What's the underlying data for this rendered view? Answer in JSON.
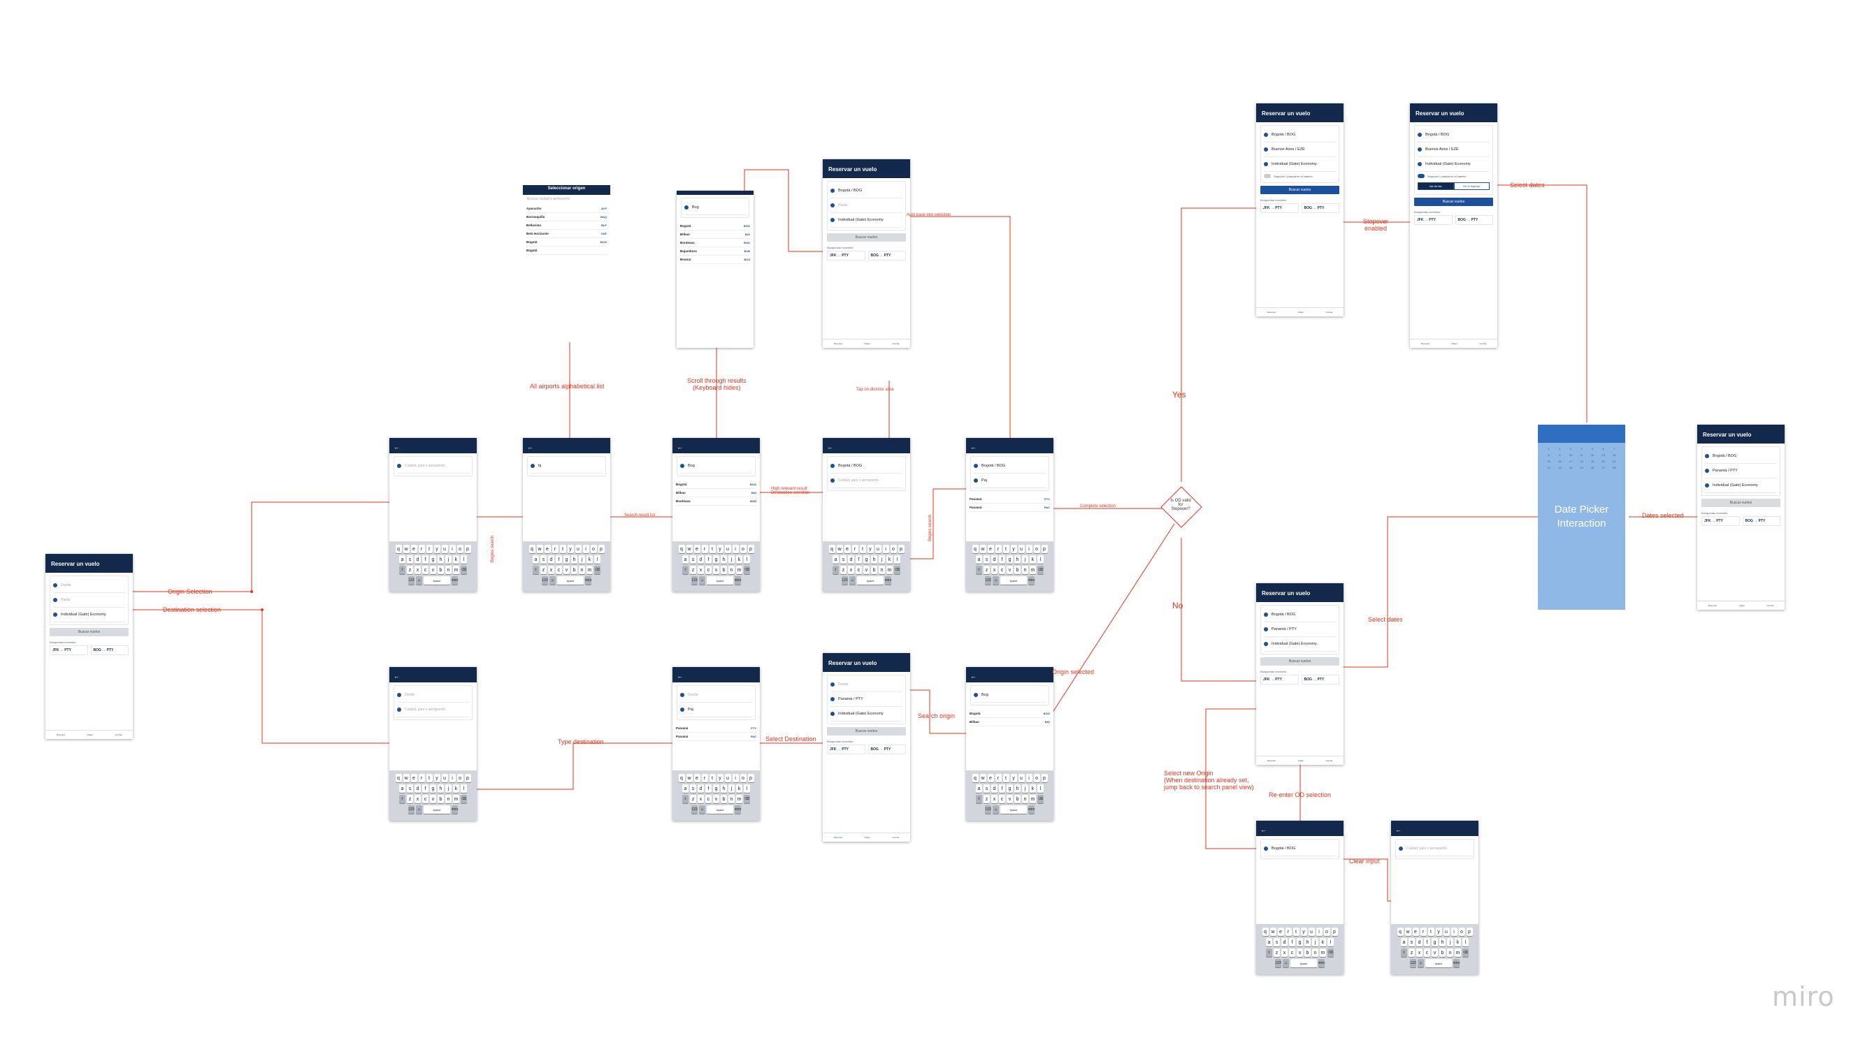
{
  "labels": {
    "origin_selection": "Origin Selection",
    "destination_selection": "Destination selection",
    "all_airports": "All airports alphabetical list",
    "scroll_results": "Scroll through results\n(Keyboard hides)",
    "tap_dismiss": "Tap on dismiss area",
    "auto_back": "Auto back into selection",
    "begins_search_1": "Begins search",
    "begins_search_2": "Begins search",
    "search_result_list": "Search result list",
    "high_relevance": "High relevant result\nDestination selection",
    "type_destination": "Type destination",
    "select_destination": "Select Destination",
    "search_origin": "Search origin",
    "origin_selected": "Origin selected",
    "complete_selection": "Complete selection",
    "yes": "Yes",
    "no": "No",
    "stopover_enabled": "Stopover\nenabled",
    "select_dates_top": "Select dates",
    "select_dates_bottom": "Select dates",
    "dates_selected": "Dates selected",
    "reenter_od": "Re-enter OD selection",
    "select_new_origin": "Select new Origin\n(When destination already set,\njump back to search panel view)",
    "clear_input": "Clear input",
    "diamond_text": "Is OD valid\nfor\nStopover?"
  },
  "screens": {
    "title": "Reservar un vuelo",
    "desde": "Desde",
    "hasta": "Hasta",
    "bogota": "Bogotá / BOG",
    "panama": "Panamá / PTY",
    "buenos_aires": "Buenos Aires / EZE",
    "pasajeros": "Individual (Gate) Economy",
    "buscar": "Buscar vuelos",
    "recent": "Búsquedas recientes",
    "chip1": "JFK → PTY",
    "chip2": "BOG → PTY",
    "placeholder": "Ciudad, país o aeropuerto",
    "query_bg": "bj",
    "query_bog": "Bog",
    "query_paj": "Paj",
    "query_pan": "Pan",
    "airports_title": "Seleccionar origen",
    "airports_search": "Buscar ciudad o aeropuerto",
    "stopover_toggle": "Stopover / parada en el camino",
    "seg_one": "Ida de ida",
    "seg_two": "En el regreso",
    "date_picker_1": "Date Picker",
    "date_picker_2": "Interaction",
    "tab_book": "Reservar",
    "tab_trips": "Viajes",
    "tab_account": "Cuenta"
  },
  "airport_list": [
    {
      "name": "Ayacucho",
      "sub": "Aeropuerto Alfredo Mendivil Duarte",
      "code": "AYP"
    },
    {
      "name": "Barranquilla",
      "sub": "Aeropuerto Ernesto Cortissoz",
      "code": "BAQ"
    },
    {
      "name": "Bellavista",
      "sub": "Aeropuerto Huallaga",
      "code": "BLP"
    },
    {
      "name": "Belo Horizonte",
      "sub": "Aeropuerto Confins",
      "code": "CNF"
    },
    {
      "name": "Bogotá",
      "sub": "El Dorado",
      "code": "BOG"
    },
    {
      "name": "Bogotá",
      "sub": "Guaymaral",
      "code": ""
    }
  ],
  "search_list": [
    {
      "name": "Bogotá",
      "sub": "Aeropuerto El Dorado",
      "code": "BOG"
    },
    {
      "name": "Bilbao",
      "sub": "Aeropuerto de Bilbao",
      "code": "BIO"
    },
    {
      "name": "Bordeaux",
      "sub": "Aeropuerto Mérignac",
      "code": "BOD"
    },
    {
      "name": "Bujumbura",
      "sub": "Aeropuerto Internacional",
      "code": "BJM"
    },
    {
      "name": "Boston",
      "sub": "Logan International",
      "code": "BOS"
    },
    {
      "name": "Bogotá",
      "sub": "Guaymaral",
      "code": ""
    }
  ],
  "destination_list": [
    {
      "name": "Panamá",
      "sub": "Aeropuerto Tocumen",
      "code": "PTY"
    },
    {
      "name": "Panamá",
      "sub": "Albrook",
      "code": "PAC"
    }
  ],
  "miro": "miro",
  "colors": {
    "navy": "#13294b",
    "accent": "#e8331c",
    "blue": "#1c4f9c"
  }
}
